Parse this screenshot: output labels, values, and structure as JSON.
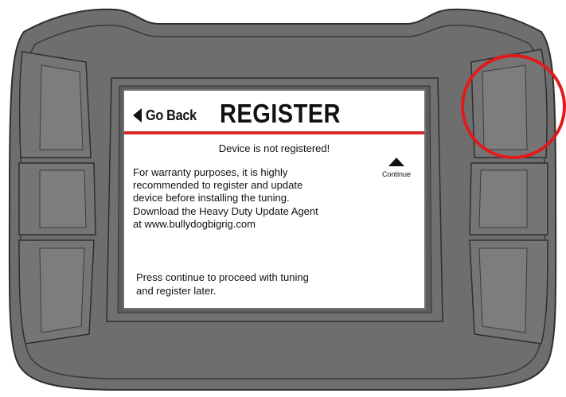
{
  "device": {
    "body_color": "#6e6e6e",
    "body_stroke": "#2e2e2e",
    "button_color": "#7a7a7a",
    "highlight_color": "#e11b1b",
    "highlighted_button": "right-top-button"
  },
  "screen": {
    "back_label": "Go Back",
    "title": "REGISTER",
    "status": "Device is not registered!",
    "body_lines": [
      "For warranty purposes, it is highly",
      "recommended to register and update",
      "device before installing the tuning.",
      "Download the Heavy Duty Update Agent",
      "at www.bullydogbigrig.com"
    ],
    "footer_lines": [
      "Press continue to proceed with tuning",
      "and register later."
    ],
    "continue_label": "Continue",
    "accent_color": "#d42a2a"
  },
  "icons": {
    "back": "left-triangle-icon",
    "continue": "up-triangle-icon"
  }
}
